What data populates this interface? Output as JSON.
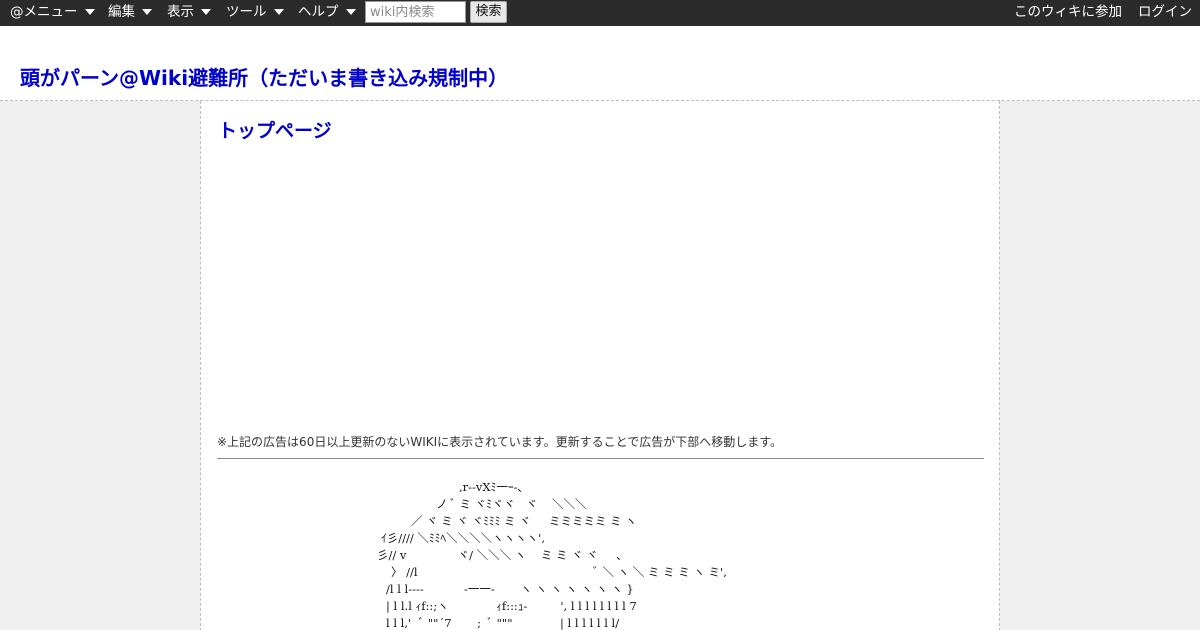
{
  "toolbar": {
    "menus": [
      {
        "label": "@メニュー"
      },
      {
        "label": "編集"
      },
      {
        "label": "表示"
      },
      {
        "label": "ツール"
      },
      {
        "label": "ヘルプ"
      }
    ],
    "search": {
      "placeholder": "wiki内検索",
      "button_label": "検索"
    },
    "right_links": [
      {
        "label": "このウィキに参加"
      },
      {
        "label": "ログイン"
      }
    ]
  },
  "header": {
    "site_title": "頭がパーン@Wiki避難所（ただいま書き込み規制中）"
  },
  "main": {
    "page_title": "トップページ",
    "ad_notice": "※上記の広告は60日以上更新のないWIKIに表示されています。更新することで広告が下部へ移動します。",
    "ascii_art": [
      ",r--vXﾐ一ｰ-､",
      "ノ ﾞ ミ ヾﾐヾヾ   ヾ    ＼＼＼",
      "／ ヾ ミ ヾ ヾﾐﾐﾐ ミ ヾ     ミミミミミ ミ ヽ",
      "ｲ彡//// ＼ﾐﾐﾍ＼＼＼＼ヽヽヽヽ',",
      "彡// v              ヾ/ ＼＼＼ ヽ    ミ ミ ヾ ヾ     、",
      "〉 //l                                                ﾞ ＼ ヽ ＼ ミ ミ ミ ヽ ミ',",
      "/l l l--‐-           ‐一一‐       ヽ ヽ ヽ ヽ ヽ ヽ ヽ }",
      "| l l.l ｨf::;ヽ             ｨf:::ｭ-         ', l l l l l l l l 7",
      "l l l,'  ﾞ \"\"´7       ;  ﾞ \"\"\"             | l l l l l l l/"
    ]
  }
}
